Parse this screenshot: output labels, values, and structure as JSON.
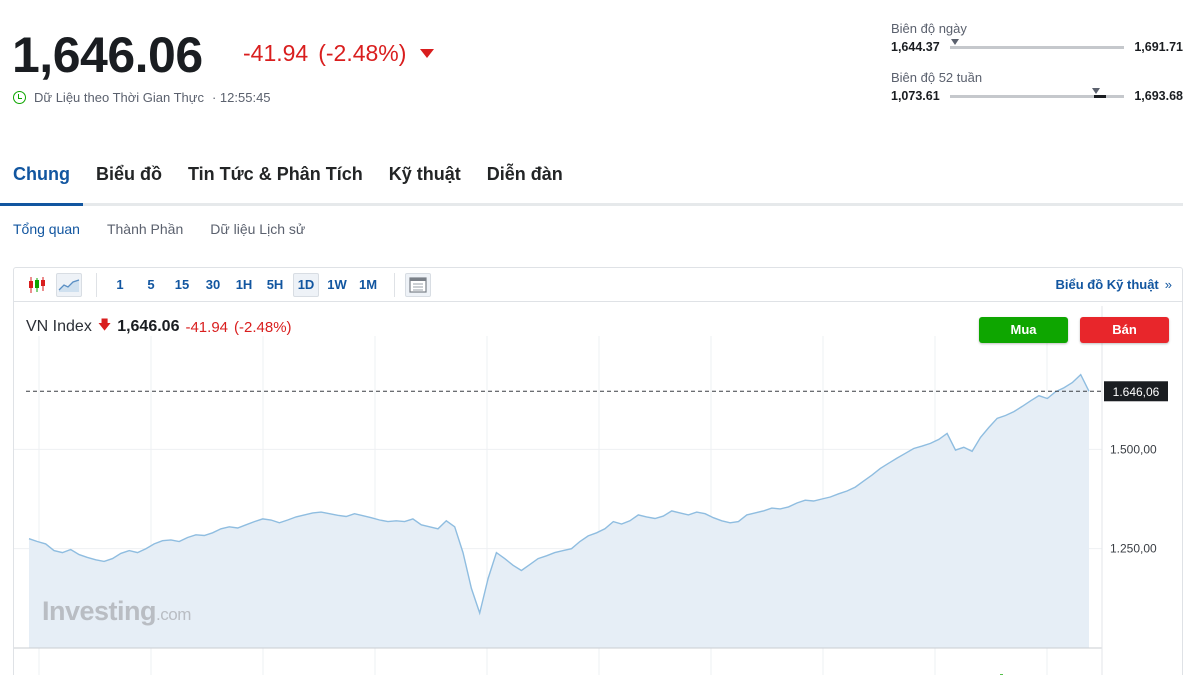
{
  "quote": {
    "price": "1,646.06",
    "change": "-41.94",
    "change_pct": "(-2.48%)",
    "realtime_label": "Dữ Liệu theo Thời Gian Thực",
    "time": "· 12:55:45",
    "down_color": "#d91e1e",
    "clock_icon": "clock-icon"
  },
  "day_range": {
    "title": "Biên độ ngày",
    "low": "1,644.37",
    "high": "1,691.71"
  },
  "week52_range": {
    "title": "Biên độ 52 tuần",
    "low": "1,073.61",
    "high": "1,693.68"
  },
  "tabs": [
    "Chung",
    "Biểu đồ",
    "Tin Tức & Phân Tích",
    "Kỹ thuật",
    "Diễn đàn"
  ],
  "subtabs": [
    "Tổng quan",
    "Thành Phần",
    "Dữ liệu Lịch sử"
  ],
  "toolbar": {
    "intervals": [
      "1",
      "5",
      "15",
      "30",
      "1H",
      "5H",
      "1D",
      "1W",
      "1M"
    ],
    "selected_interval": "1D",
    "tech_chart_link": "Biểu đồ Kỹ thuật",
    "tech_chart_chevron": "»"
  },
  "legend": {
    "name": "VN Index",
    "arrow": "🡇",
    "value": "1,646.06",
    "change": "-41.94",
    "change_pct": "(-2.48%)"
  },
  "buttons": {
    "buy": "Mua",
    "sell": "Bán"
  },
  "watermark": {
    "main": "Investing",
    "suffix": ".com"
  },
  "chart_data": {
    "type": "area",
    "ylim": [
      1000,
      1760
    ],
    "y_ticks": [
      1250,
      1500
    ],
    "y_tick_labels": [
      "1.250,00",
      "1.500,00"
    ],
    "last_price_label": "1.646,06",
    "last_price": 1646.06,
    "grid": true,
    "line_color": "#8fbde0",
    "fill_color": "#e6eef6",
    "values": [
      1275,
      1268,
      1262,
      1245,
      1240,
      1248,
      1235,
      1228,
      1222,
      1218,
      1225,
      1238,
      1245,
      1240,
      1250,
      1262,
      1270,
      1272,
      1268,
      1278,
      1285,
      1283,
      1290,
      1300,
      1305,
      1302,
      1310,
      1318,
      1325,
      1322,
      1315,
      1322,
      1330,
      1335,
      1340,
      1342,
      1338,
      1334,
      1331,
      1338,
      1333,
      1328,
      1322,
      1318,
      1320,
      1318,
      1325,
      1310,
      1305,
      1300,
      1320,
      1305,
      1240,
      1150,
      1088,
      1175,
      1240,
      1225,
      1208,
      1195,
      1210,
      1225,
      1232,
      1240,
      1245,
      1250,
      1268,
      1282,
      1290,
      1300,
      1318,
      1312,
      1320,
      1335,
      1330,
      1326,
      1332,
      1345,
      1340,
      1335,
      1342,
      1338,
      1328,
      1320,
      1315,
      1318,
      1335,
      1340,
      1345,
      1352,
      1350,
      1355,
      1365,
      1372,
      1370,
      1375,
      1380,
      1388,
      1395,
      1405,
      1420,
      1435,
      1452,
      1465,
      1478,
      1490,
      1502,
      1508,
      1515,
      1525,
      1540,
      1498,
      1505,
      1495,
      1530,
      1555,
      1578,
      1585,
      1595,
      1608,
      1622,
      1635,
      1628,
      1645,
      1655,
      1668,
      1688,
      1646
    ]
  }
}
